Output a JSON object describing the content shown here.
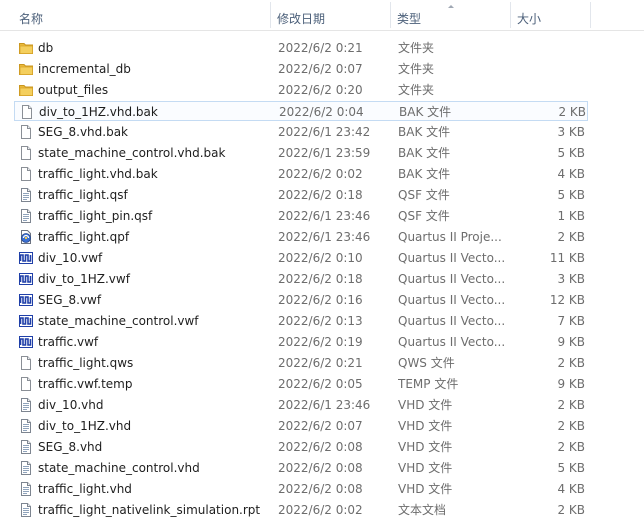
{
  "columns": {
    "name": "名称",
    "date": "修改日期",
    "type": "类型",
    "size": "大小"
  },
  "files": [
    {
      "name": "db",
      "date": "2022/6/2 0:21",
      "type": "文件夹",
      "size": "",
      "icon": "folder-icon"
    },
    {
      "name": "incremental_db",
      "date": "2022/6/2 0:07",
      "type": "文件夹",
      "size": "",
      "icon": "folder-icon"
    },
    {
      "name": "output_files",
      "date": "2022/6/2 0:20",
      "type": "文件夹",
      "size": "",
      "icon": "folder-icon"
    },
    {
      "name": "div_to_1HZ.vhd.bak",
      "date": "2022/6/2 0:04",
      "type": "BAK 文件",
      "size": "2 KB",
      "icon": "document-icon"
    },
    {
      "name": "SEG_8.vhd.bak",
      "date": "2022/6/1 23:42",
      "type": "BAK 文件",
      "size": "3 KB",
      "icon": "document-icon"
    },
    {
      "name": "state_machine_control.vhd.bak",
      "date": "2022/6/1 23:59",
      "type": "BAK 文件",
      "size": "5 KB",
      "icon": "document-icon"
    },
    {
      "name": "traffic_light.vhd.bak",
      "date": "2022/6/2 0:02",
      "type": "BAK 文件",
      "size": "4 KB",
      "icon": "document-icon"
    },
    {
      "name": "traffic_light.qsf",
      "date": "2022/6/2 0:18",
      "type": "QSF 文件",
      "size": "5 KB",
      "icon": "text-document-icon"
    },
    {
      "name": "traffic_light_pin.qsf",
      "date": "2022/6/1 23:46",
      "type": "QSF 文件",
      "size": "1 KB",
      "icon": "text-document-icon"
    },
    {
      "name": "traffic_light.qpf",
      "date": "2022/6/1 23:46",
      "type": "Quartus II Proje...",
      "size": "2 KB",
      "icon": "quartus-project-icon"
    },
    {
      "name": "div_10.vwf",
      "date": "2022/6/2 0:10",
      "type": "Quartus II Vecto...",
      "size": "11 KB",
      "icon": "waveform-icon"
    },
    {
      "name": "div_to_1HZ.vwf",
      "date": "2022/6/2 0:18",
      "type": "Quartus II Vecto...",
      "size": "3 KB",
      "icon": "waveform-icon"
    },
    {
      "name": "SEG_8.vwf",
      "date": "2022/6/2 0:16",
      "type": "Quartus II Vecto...",
      "size": "12 KB",
      "icon": "waveform-icon"
    },
    {
      "name": "state_machine_control.vwf",
      "date": "2022/6/2 0:13",
      "type": "Quartus II Vecto...",
      "size": "7 KB",
      "icon": "waveform-icon"
    },
    {
      "name": "traffic.vwf",
      "date": "2022/6/2 0:19",
      "type": "Quartus II Vecto...",
      "size": "9 KB",
      "icon": "waveform-icon"
    },
    {
      "name": "traffic_light.qws",
      "date": "2022/6/2 0:21",
      "type": "QWS 文件",
      "size": "2 KB",
      "icon": "document-icon"
    },
    {
      "name": "traffic.vwf.temp",
      "date": "2022/6/2 0:05",
      "type": "TEMP 文件",
      "size": "9 KB",
      "icon": "document-icon"
    },
    {
      "name": "div_10.vhd",
      "date": "2022/6/1 23:46",
      "type": "VHD 文件",
      "size": "2 KB",
      "icon": "text-document-icon"
    },
    {
      "name": "div_to_1HZ.vhd",
      "date": "2022/6/2 0:07",
      "type": "VHD 文件",
      "size": "2 KB",
      "icon": "text-document-icon"
    },
    {
      "name": "SEG_8.vhd",
      "date": "2022/6/2 0:08",
      "type": "VHD 文件",
      "size": "2 KB",
      "icon": "text-document-icon"
    },
    {
      "name": "state_machine_control.vhd",
      "date": "2022/6/2 0:08",
      "type": "VHD 文件",
      "size": "5 KB",
      "icon": "text-document-icon"
    },
    {
      "name": "traffic_light.vhd",
      "date": "2022/6/2 0:08",
      "type": "VHD 文件",
      "size": "4 KB",
      "icon": "text-document-icon"
    },
    {
      "name": "traffic_light_nativelink_simulation.rpt",
      "date": "2022/6/2 0:02",
      "type": "文本文档",
      "size": "2 KB",
      "icon": "text-document-icon"
    }
  ],
  "selected_index": 3
}
